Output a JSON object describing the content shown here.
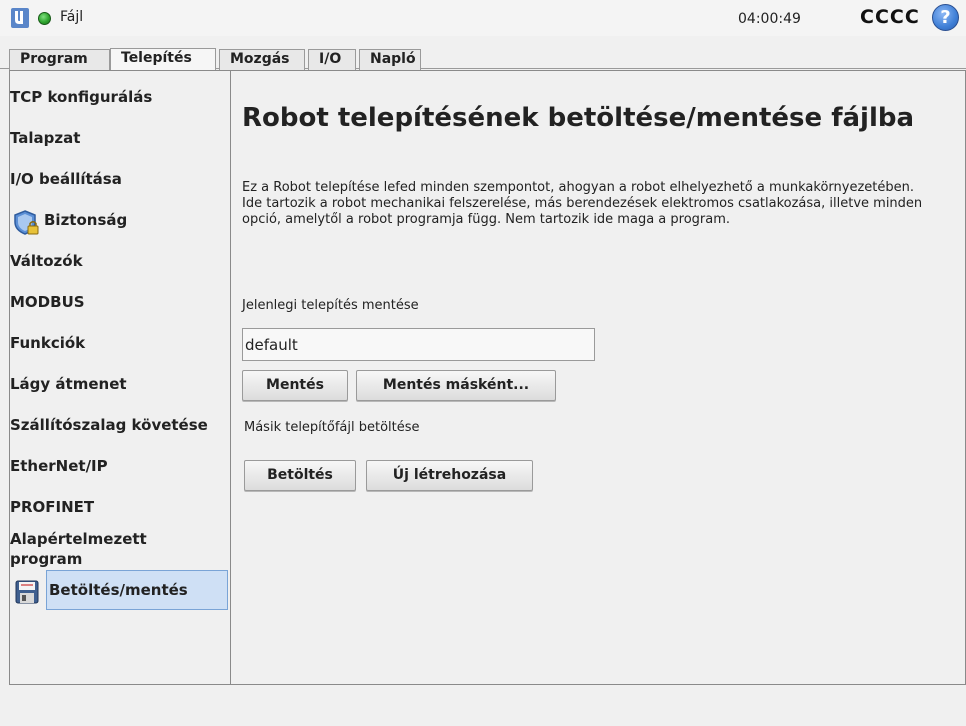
{
  "topbar": {
    "file_menu": "Fájl",
    "clock": "04:00:49",
    "robot_name": "CCCC",
    "help_symbol": "?",
    "icons": {
      "logo": "ur-logo-icon",
      "status": "status-ok-icon",
      "help": "help-icon"
    },
    "status_color": "#2fa52f"
  },
  "tabs": [
    {
      "label": "Program",
      "active": false
    },
    {
      "label": "Telepítés",
      "active": true
    },
    {
      "label": "Mozgás",
      "active": false
    },
    {
      "label": "I/O",
      "active": false
    },
    {
      "label": "Napló",
      "active": false
    }
  ],
  "sidebar": {
    "items": [
      {
        "label": "TCP konfigurálás"
      },
      {
        "label": "Talapzat"
      },
      {
        "label": "I/O beállítása"
      },
      {
        "label": "Biztonság",
        "icon": "shield-lock-icon"
      },
      {
        "label": "Változók"
      },
      {
        "label": "MODBUS"
      },
      {
        "label": "Funkciók"
      },
      {
        "label": "Lágy átmenet"
      },
      {
        "label": "Szállítószalag követése"
      },
      {
        "label": "EtherNet/IP"
      },
      {
        "label": "PROFINET"
      },
      {
        "label": "Alapértelmezett program"
      },
      {
        "label": "Betöltés/mentés",
        "icon": "floppy-disk-icon",
        "selected": true
      }
    ],
    "selected_color": "#cfe0f5"
  },
  "content": {
    "title": "Robot telepítésének betöltése/mentése fájlba",
    "description": "Ez a Robot telepítése lefed minden szempontot, ahogyan a robot elhelyezhető a munkakörnyezetében. Ide tartozik a robot mechanikai felszerelése, más berendezések elektromos csatlakozása, illetve minden opció, amelytől a robot programja függ. Nem tartozik ide maga a program.",
    "save_section_label": "Jelenlegi telepítés mentése",
    "filename_value": "default",
    "save_button": "Mentés",
    "save_as_button": "Mentés másként...",
    "load_section_label": "Másik telepítőfájl betöltése",
    "load_button": "Betöltés",
    "new_button": "Új létrehozása"
  }
}
